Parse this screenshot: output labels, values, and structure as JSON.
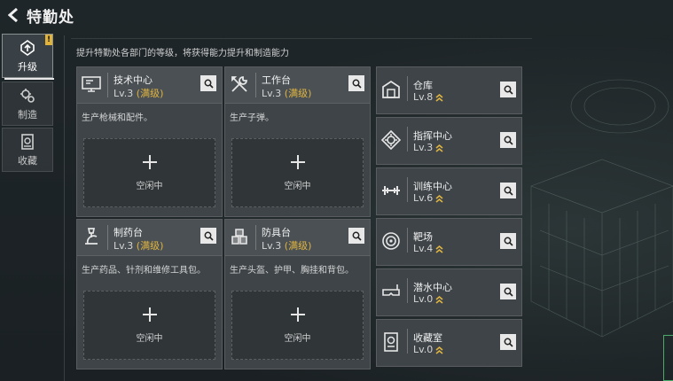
{
  "header": {
    "title": "特勤处"
  },
  "sidebar": {
    "items": [
      {
        "label": "升级",
        "icon": "upgrade-icon",
        "active": true
      },
      {
        "label": "制造",
        "icon": "craft-icon"
      },
      {
        "label": "收藏",
        "icon": "collection-icon"
      }
    ],
    "alert": "!"
  },
  "description": "提升特勤处各部门的等级，将获得能力提升和制造能力",
  "big_cards": [
    {
      "name": "技术中心",
      "level": "Lv.3",
      "max": "(满级)",
      "desc": "生产枪械和配件。",
      "slot": "空闲中",
      "icon": "computer-icon"
    },
    {
      "name": "工作台",
      "level": "Lv.3",
      "max": "(满级)",
      "desc": "生产子弹。",
      "slot": "空闲中",
      "icon": "tools-icon"
    },
    {
      "name": "制药台",
      "level": "Lv.3",
      "max": "(满级)",
      "desc": "生产药品、针剂和维修工具包。",
      "slot": "空闲中",
      "icon": "microscope-icon"
    },
    {
      "name": "防具台",
      "level": "Lv.3",
      "max": "(满级)",
      "desc": "生产头盔、护甲、胸挂和背包。",
      "slot": "空闲中",
      "icon": "armor-icon"
    }
  ],
  "small_cards": [
    {
      "name": "仓库",
      "level": "Lv.8",
      "icon": "warehouse-icon"
    },
    {
      "name": "指挥中心",
      "level": "Lv.3",
      "icon": "command-icon"
    },
    {
      "name": "训练中心",
      "level": "Lv.6",
      "icon": "dumbbell-icon"
    },
    {
      "name": "靶场",
      "level": "Lv.4",
      "icon": "target-icon"
    },
    {
      "name": "潜水中心",
      "level": "Lv.0",
      "icon": "diving-mask-icon"
    },
    {
      "name": "收藏室",
      "level": "Lv.0",
      "icon": "display-case-icon"
    }
  ],
  "colors": {
    "accent": "#e0b440",
    "panel": "#3e4448",
    "background": "#1d2327"
  }
}
